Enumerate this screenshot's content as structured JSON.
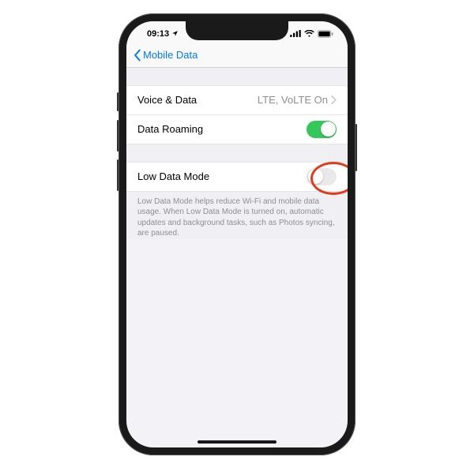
{
  "status": {
    "time": "09:13"
  },
  "nav": {
    "back_label": "Mobile Data"
  },
  "rows": {
    "voice_data": {
      "label": "Voice & Data",
      "value": "LTE, VoLTE On"
    },
    "data_roaming": {
      "label": "Data Roaming"
    },
    "low_data": {
      "label": "Low Data Mode"
    }
  },
  "footer": {
    "low_data_note": "Low Data Mode helps reduce Wi-Fi and mobile data usage. When Low Data Mode is turned on, automatic updates and background tasks, such as Photos syncing, are paused."
  }
}
